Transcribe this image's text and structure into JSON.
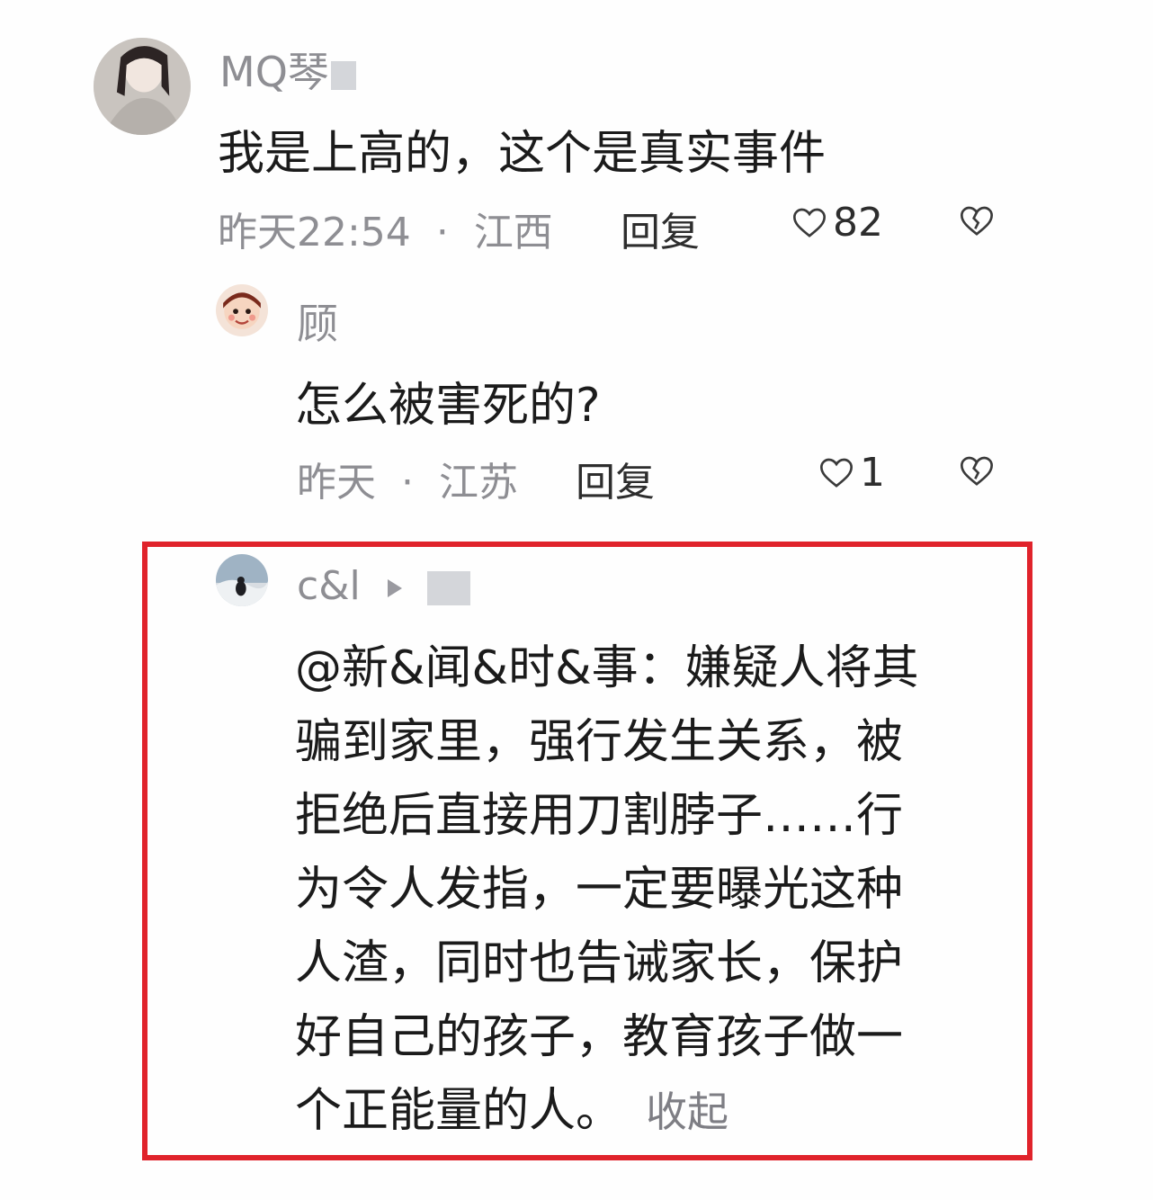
{
  "comments": [
    {
      "username": "MQ琴",
      "content": "我是上高的，这个是真实事件",
      "time": "昨天22:54",
      "location": "江西",
      "reply_label": "回复",
      "likes": "82"
    },
    {
      "username": "顾",
      "content": "怎么被害死的?",
      "time": "昨天",
      "location": "江苏",
      "reply_label": "回复",
      "likes": "1"
    },
    {
      "username": "c&l",
      "content": "@新&闻&时&事：嫌疑人将其骗到家里，强行发生关系，被拒绝后直接用刀割脖子……行为令人发指，一定要曝光这种人渣，同时也告诫家长，保护好自己的孩子，教育孩子做一个正能量的人。",
      "lines": [
        "@新&闻&时&事：嫌疑人将其",
        "骗到家里，强行发生关系，被",
        "拒绝后直接用刀割脖子……行",
        "为令人发指，一定要曝光这种",
        "人渣，同时也告诫家长，保护",
        "好自己的孩子，教育孩子做一",
        "个正能量的人。"
      ],
      "collapse_label": "收起"
    }
  ],
  "meta_separator": "·",
  "colors": {
    "highlight_border": "#e0232b",
    "meta_text": "#8e8e93",
    "body_text": "#1b1b1b"
  },
  "icons": [
    "heart-outline-icon",
    "broken-heart-icon",
    "play-triangle-icon"
  ]
}
